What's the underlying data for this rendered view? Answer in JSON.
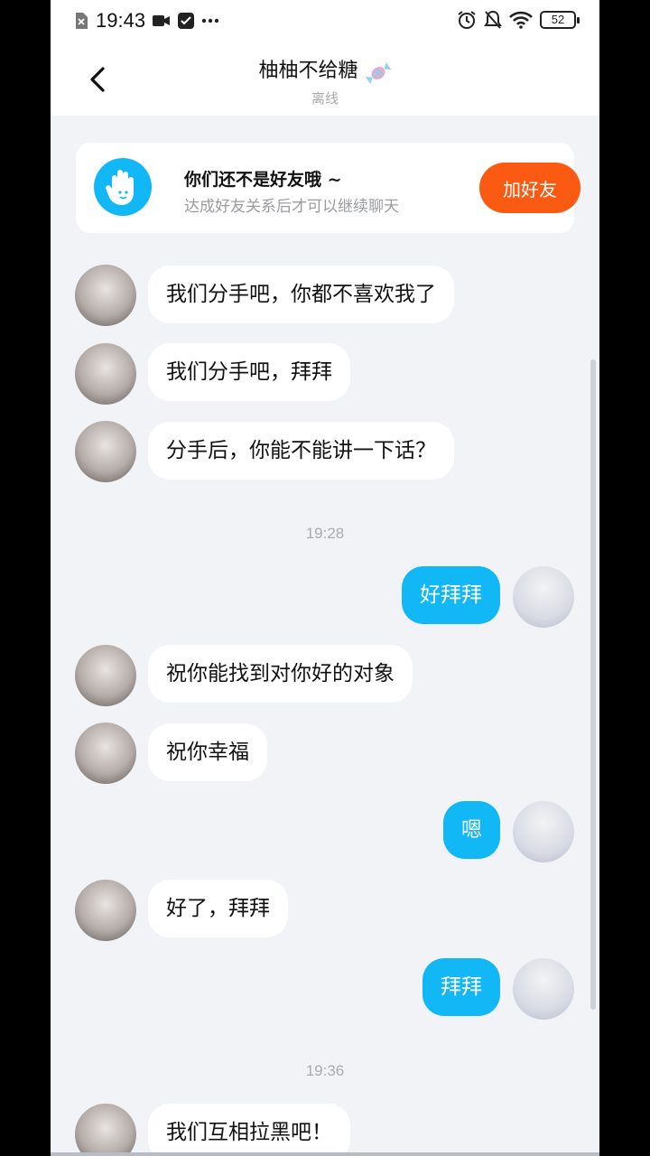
{
  "status_bar": {
    "time": "19:43",
    "battery": "52"
  },
  "header": {
    "title": "柚柚不给糖",
    "subtitle": "离线"
  },
  "banner": {
    "title": "你们还不是好友哦 ~",
    "subtitle": "达成好友关系后才可以继续聊天",
    "add_button": "加好友"
  },
  "messages": [
    {
      "side": "left",
      "text": "我们分手吧，你都不喜欢我了"
    },
    {
      "side": "left",
      "text": "我们分手吧，拜拜"
    },
    {
      "side": "left",
      "text": "分手后，你能不能讲一下话？"
    },
    {
      "type": "time",
      "text": "19:28"
    },
    {
      "side": "right",
      "text": "好拜拜"
    },
    {
      "side": "left",
      "text": "祝你能找到对你好的对象"
    },
    {
      "side": "left",
      "text": "祝你幸福"
    },
    {
      "side": "right",
      "text": "嗯"
    },
    {
      "side": "left",
      "text": "好了，拜拜"
    },
    {
      "side": "right",
      "text": "拜拜"
    },
    {
      "type": "time",
      "text": "19:36"
    },
    {
      "side": "left",
      "text": "我们互相拉黑吧！"
    }
  ],
  "colors": {
    "accent_blue": "#12b7f5",
    "add_button": "#fb5a13",
    "chat_bg": "#f2f3f7"
  }
}
